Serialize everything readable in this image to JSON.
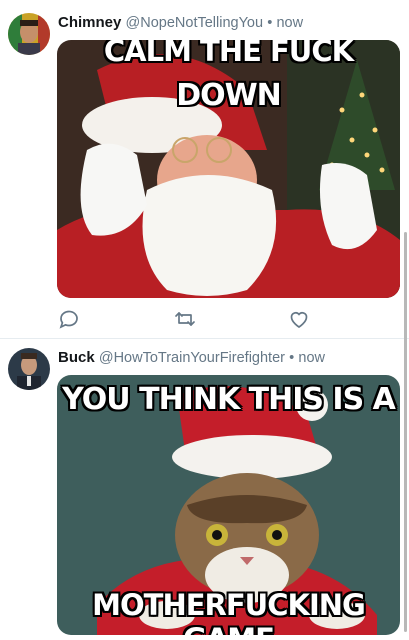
{
  "tweets": [
    {
      "display_name": "Chimney",
      "handle": "@NopeNotTellingYou",
      "separator": "•",
      "time": "now",
      "meme_top": "CALM THE FUCK",
      "meme_bottom": "DOWN",
      "actions": [
        "reply-icon",
        "retweet-icon",
        "like-icon"
      ]
    },
    {
      "display_name": "Buck",
      "handle": "@HowToTrainYourFirefighter",
      "separator": "•",
      "time": "now",
      "meme_top": "YOU THINK THIS IS A",
      "meme_bottom": "MOTHERFUCKING GAME"
    }
  ],
  "colors": {
    "secondary_text": "#657786",
    "divider": "#e6ecf0",
    "icon": "#657786"
  }
}
